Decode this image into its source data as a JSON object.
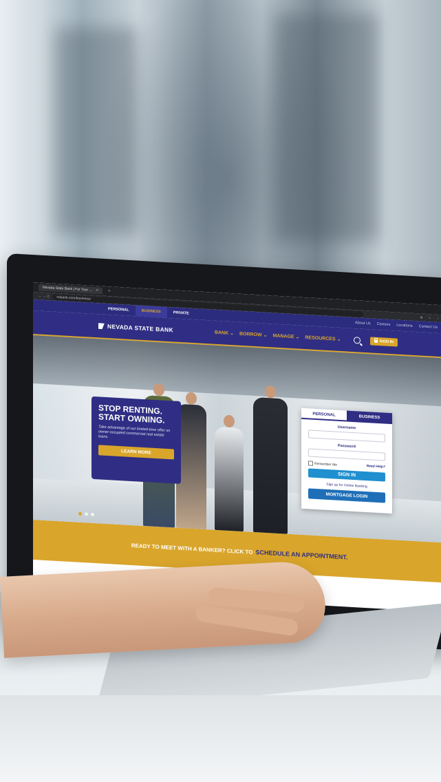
{
  "browser": {
    "tab_title": "Nevada State Bank | For Your ...",
    "tab_close": "×",
    "tab_new": "+",
    "nav_buttons": "← → C",
    "url": "nsbank.com/business/",
    "toolbar_icons": "⊕ ☆ ⋮"
  },
  "site": {
    "segments": [
      "PERSONAL",
      "BUSINESS",
      "PRIVATE"
    ],
    "utility_links": [
      "About Us",
      "Careers",
      "Locations",
      "Contact Us"
    ],
    "brand": "NEVADA STATE BANK",
    "menu": [
      "BANK ⌄",
      "BORROW ⌄",
      "MANAGE ⌄",
      "RESOURCES ⌄"
    ],
    "sign_in": "SIGN IN",
    "colors": {
      "navy": "#2f2e84",
      "gold": "#d9a52b",
      "blue": "#1f8fd0"
    }
  },
  "promo": {
    "title_line1": "STOP RENTING.",
    "title_line2": "START OWNING.",
    "body": "Take advantage of our limited-time offer on owner-occupied commercial real estate loans.",
    "button": "LEARN MORE"
  },
  "login": {
    "tab_personal": "PERSONAL",
    "tab_business": "BUSINESS",
    "username_label": "Username",
    "password_label": "Password",
    "remember": "Remember Me",
    "help": "Need Help?",
    "sign_in": "SIGN IN",
    "signup": "Sign up for Online Banking",
    "mortgage": "MORTGAGE LOGIN"
  },
  "banner": {
    "lead": "READY TO MEET WITH A BANKER? CLICK TO",
    "link": "SCHEDULE AN APPOINTMENT."
  }
}
